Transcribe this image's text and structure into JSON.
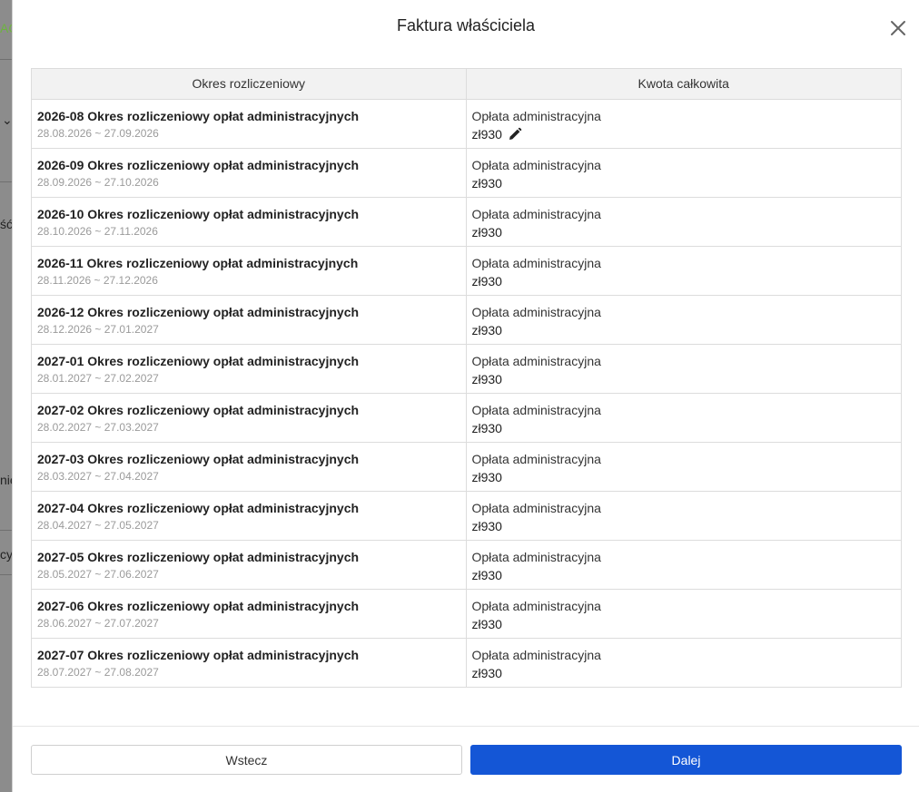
{
  "background": {
    "fragments": [
      "AG",
      "ść",
      "nie",
      "cy"
    ]
  },
  "modal": {
    "title": "Faktura właściciela"
  },
  "table": {
    "headers": [
      "Okres rozliczeniowy",
      "Kwota całkowita"
    ],
    "rows": [
      {
        "title": "2026-08 Okres rozliczeniowy opłat administracyjnych",
        "dates": "28.08.2026 ~ 27.09.2026",
        "fee": "Opłata administracyjna",
        "amount": "zł930"
      },
      {
        "title": "2026-09 Okres rozliczeniowy opłat administracyjnych",
        "dates": "28.09.2026 ~ 27.10.2026",
        "fee": "Opłata administracyjna",
        "amount": "zł930"
      },
      {
        "title": "2026-10 Okres rozliczeniowy opłat administracyjnych",
        "dates": "28.10.2026 ~ 27.11.2026",
        "fee": "Opłata administracyjna",
        "amount": "zł930"
      },
      {
        "title": "2026-11 Okres rozliczeniowy opłat administracyjnych",
        "dates": "28.11.2026 ~ 27.12.2026",
        "fee": "Opłata administracyjna",
        "amount": "zł930"
      },
      {
        "title": "2026-12 Okres rozliczeniowy opłat administracyjnych",
        "dates": "28.12.2026 ~ 27.01.2027",
        "fee": "Opłata administracyjna",
        "amount": "zł930"
      },
      {
        "title": "2027-01 Okres rozliczeniowy opłat administracyjnych",
        "dates": "28.01.2027 ~ 27.02.2027",
        "fee": "Opłata administracyjna",
        "amount": "zł930"
      },
      {
        "title": "2027-02 Okres rozliczeniowy opłat administracyjnych",
        "dates": "28.02.2027 ~ 27.03.2027",
        "fee": "Opłata administracyjna",
        "amount": "zł930"
      },
      {
        "title": "2027-03 Okres rozliczeniowy opłat administracyjnych",
        "dates": "28.03.2027 ~ 27.04.2027",
        "fee": "Opłata administracyjna",
        "amount": "zł930"
      },
      {
        "title": "2027-04 Okres rozliczeniowy opłat administracyjnych",
        "dates": "28.04.2027 ~ 27.05.2027",
        "fee": "Opłata administracyjna",
        "amount": "zł930"
      },
      {
        "title": "2027-05 Okres rozliczeniowy opłat administracyjnych",
        "dates": "28.05.2027 ~ 27.06.2027",
        "fee": "Opłata administracyjna",
        "amount": "zł930"
      },
      {
        "title": "2027-06 Okres rozliczeniowy opłat administracyjnych",
        "dates": "28.06.2027 ~ 27.07.2027",
        "fee": "Opłata administracyjna",
        "amount": "zł930"
      },
      {
        "title": "2027-07 Okres rozliczeniowy opłat administracyjnych",
        "dates": "28.07.2027 ~ 27.08.2027",
        "fee": "Opłata administracyjna",
        "amount": "zł930"
      }
    ]
  },
  "footer": {
    "back_label": "Wstecz",
    "next_label": "Dalej"
  },
  "icons": {
    "close": "close-icon",
    "edit": "pencil-icon"
  },
  "colors": {
    "primary": "#1456d6",
    "brand_green": "#6db33f"
  }
}
